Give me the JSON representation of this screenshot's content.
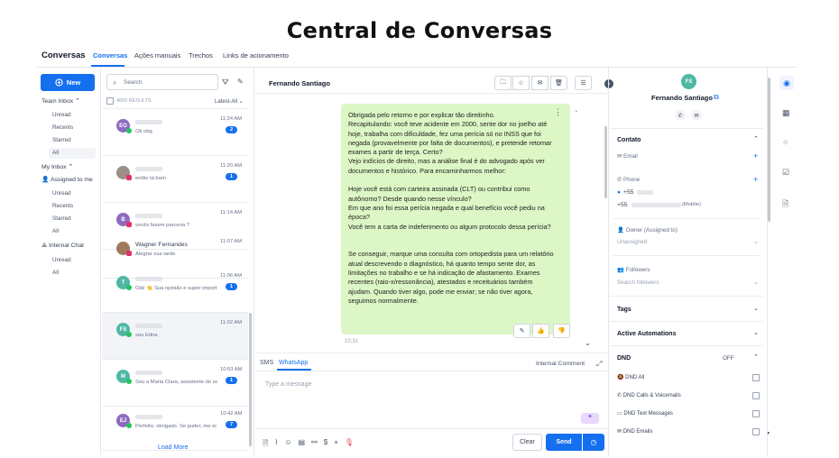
{
  "headline": "Central de Conversas",
  "topnav": {
    "app_title": "Conversas",
    "tabs": [
      "Conversas",
      "Ações manuais",
      "Trechos",
      "Links de acionamento"
    ]
  },
  "sidebar": {
    "new_label": "New",
    "team_inbox": "Team Inbox",
    "team_items": [
      "Unread",
      "Recents",
      "Starred",
      "All"
    ],
    "my_inbox": "My Inbox",
    "assigned": "Assigned to me",
    "my_items": [
      "Unread",
      "Recents",
      "Starred",
      "All"
    ],
    "internal_chat": "Internal Chat",
    "internal_items": [
      "Unread",
      "All"
    ]
  },
  "list": {
    "search_placeholder": "Search",
    "results": "4850 RESULTS",
    "sort": "Latest-All",
    "load_more": "Load More",
    "rows": [
      {
        "initials": "EO",
        "name": "",
        "preview": "Ok obg",
        "time": "11:24 AM",
        "badge": "2",
        "channel": "whatsapp",
        "color": "#8e6bbf"
      },
      {
        "initials": "",
        "name": "",
        "preview": "então tá bom",
        "time": "11:20 AM",
        "badge": "1",
        "channel": "instagram",
        "color": "#9c8f86"
      },
      {
        "initials": "B",
        "name": "",
        "preview": "vocês fazem parceria ?",
        "time": "11:14 AM",
        "badge": "",
        "channel": "instagram",
        "color": "#8e6bbf"
      },
      {
        "initials": "",
        "name": "Wagner Fernandes",
        "preview": "Alegrar sua tarde",
        "time": "11:07 AM",
        "badge": "",
        "channel": "instagram",
        "color": "#a07a5c"
      },
      {
        "initials": "T",
        "name": "",
        "preview": "Olá! 👋 Sua opinião é super import",
        "time": "11:06 AM",
        "badge": "1",
        "channel": "whatsapp",
        "color": "#4fb7a4"
      },
      {
        "initials": "FS",
        "name": "",
        "preview": "sou Edna",
        "time": "11:02 AM",
        "badge": "",
        "channel": "whatsapp",
        "color": "#4fb7a4"
      },
      {
        "initials": "M",
        "name": "",
        "preview": "Sou a Maria Clara, assistente do sc",
        "time": "10:53 AM",
        "badge": "1",
        "channel": "whatsapp",
        "color": "#4fb7a4"
      },
      {
        "initials": "EJ",
        "name": "",
        "preview": "Perfeito, obrigado. Se puder, me er",
        "time": "10:42 AM",
        "badge": "7",
        "channel": "whatsapp",
        "color": "#8e6bbf"
      }
    ]
  },
  "conversation": {
    "contact_name": "Fernando Santiago",
    "message": "Obrigada pelo retorno e por explicar tão direitinho.\nRecapitulando: você teve acidente em 2000, sente dor no joelho até hoje, trabalha com dificuldade, fez uma perícia só no INSS que foi negada (provavelmente por falta de documentos), e pretende retomar exames a partir de terça. Certo?\nVejo indícios de direito, mas a análise final é do advogado após ver documentos e histórico. Para encaminharmos melhor:\n\nHoje você está com carteira assinada (CLT) ou contribui como autônomo? Desde quando nesse vínculo?\nEm que ano foi essa perícia negada e qual benefício você pediu na época?\nVocê tem a carta de indeferimento ou algum protocolo dessa perícia?\n\n\nSe conseguir, marque uma consulta com ortopedista para um relatório atual descrevendo o diagnóstico, há quanto tempo sente dor, as limitações no trabalho e se há indicação de afastamento. Exames recentes (raio-x/ressonância), atestados e receituários também ajudam. Quando tiver algo, pode me enviar; se não tiver agora, seguimos normalmente.",
    "time": "10:31",
    "composer_tabs": [
      "SMS",
      "WhatsApp"
    ],
    "internal_comment": "Internal Comment",
    "placeholder": "Type a message",
    "clear": "Clear",
    "send": "Send"
  },
  "contact": {
    "initials": "FS",
    "name": "Fernando Santiago",
    "contato": "Contato",
    "email": "Email",
    "phone": "Phone",
    "phone1": "+55",
    "phone2": "+55",
    "mobile": "(Mobile)",
    "owner_label": "Owner (Assigned to)",
    "owner_value": "Unassigned",
    "followers": "Followers",
    "followers_placeholder": "Search followers",
    "tags": "Tags",
    "automations": "Active Automations",
    "dnd": "DND",
    "dnd_state": "OFF",
    "dnd_items": [
      "DND All",
      "DND Calls & Voicemails",
      "DND Text Messages",
      "DND Emails"
    ]
  },
  "colors": {
    "accent": "#1570ef",
    "message_bg": "#dcf7c5",
    "avatar_fs": "#4fb7a4"
  }
}
